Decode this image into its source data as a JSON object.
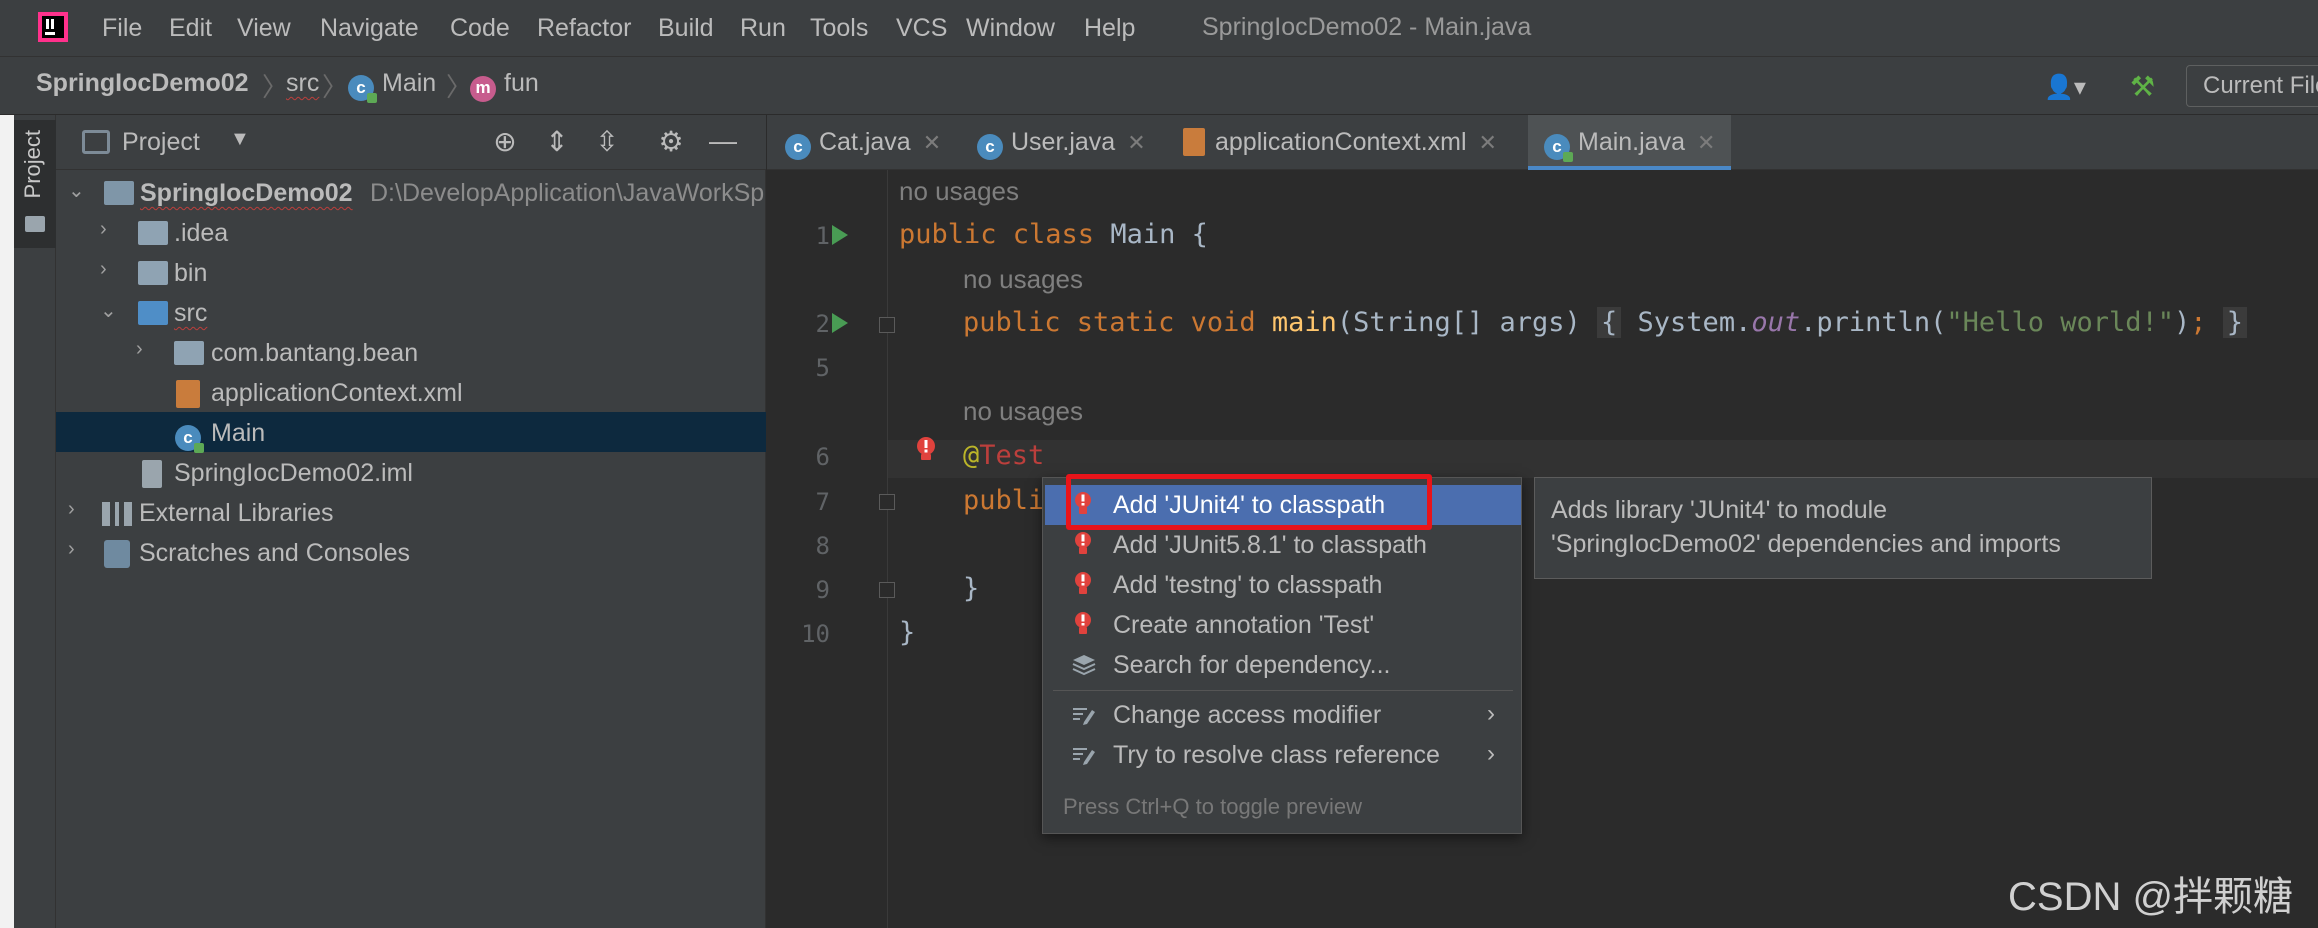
{
  "menubar": {
    "items": [
      "File",
      "Edit",
      "View",
      "Navigate",
      "Code",
      "Refactor",
      "Build",
      "Run",
      "Tools",
      "VCS",
      "Window",
      "Help"
    ],
    "window_title": "SpringIocDemo02 - Main.java"
  },
  "breadcrumb": {
    "project": "SpringIocDemo02",
    "folder": "src",
    "class": "Main",
    "method": "fun",
    "run_config": "Current File"
  },
  "toolwindow": {
    "project_tab": "Project"
  },
  "project_panel": {
    "title": "Project",
    "tree": [
      {
        "label": "SpringIocDemo02",
        "path": "D:\\DevelopApplication\\JavaWorkSp"
      },
      {
        "label": ".idea"
      },
      {
        "label": "bin"
      },
      {
        "label": "src"
      },
      {
        "label": "com.bantang.bean"
      },
      {
        "label": "applicationContext.xml"
      },
      {
        "label": "Main"
      },
      {
        "label": "SpringIocDemo02.iml"
      },
      {
        "label": "External Libraries"
      },
      {
        "label": "Scratches and Consoles"
      }
    ]
  },
  "tabs": [
    {
      "label": "Cat.java",
      "icon": "class-icon"
    },
    {
      "label": "User.java",
      "icon": "class-icon"
    },
    {
      "label": "applicationContext.xml",
      "icon": "xml-file-icon"
    },
    {
      "label": "Main.java",
      "icon": "class-icon",
      "active": true
    }
  ],
  "editor": {
    "usage_hint": "no usages",
    "line_numbers": [
      "1",
      "2",
      "5",
      "6",
      "7",
      "8",
      "9",
      "10"
    ],
    "lines": {
      "l1_kw": "public class",
      "l1_rest": " Main {",
      "l2_kw": "public static void",
      "l2_fn": "main",
      "l2_args": "(String[] args)",
      "l2_open": "{",
      "l2_sys": " System.",
      "l2_out": "out",
      "l2_print": ".println(",
      "l2_str": "\"Hello world!\"",
      "l2_end": ")",
      "l2_semi": ";",
      "l2_close": "}",
      "l6_at": "@",
      "l6_ann": "Test",
      "l7": "publi",
      "l9": "}",
      "l10": "}"
    }
  },
  "popup": {
    "items": [
      {
        "label": "Add 'JUnit4' to classpath",
        "icon": "error-bulb-icon",
        "selected": true
      },
      {
        "label": "Add 'JUnit5.8.1' to classpath",
        "icon": "error-bulb-icon"
      },
      {
        "label": "Add 'testng' to classpath",
        "icon": "error-bulb-icon"
      },
      {
        "label": "Create annotation 'Test'",
        "icon": "error-bulb-icon"
      },
      {
        "label": "Search for dependency...",
        "icon": "stack-icon"
      },
      {
        "label": "Change access modifier",
        "icon": "pencil-icon",
        "submenu": true
      },
      {
        "label": "Try to resolve class reference",
        "icon": "pencil-icon",
        "submenu": true
      }
    ],
    "footer": "Press Ctrl+Q to toggle preview"
  },
  "tooltip": {
    "line1": "Adds library 'JUnit4' to module",
    "line2": "'SpringIocDemo02' dependencies and imports"
  },
  "watermark": "CSDN @拌颗糖",
  "colors": {
    "accent": "#4b6eaf",
    "highlight_box": "#e8141a",
    "keyword": "#cc7832",
    "string": "#6a8759",
    "function": "#ffc66d",
    "error": "#bc3f3c"
  }
}
